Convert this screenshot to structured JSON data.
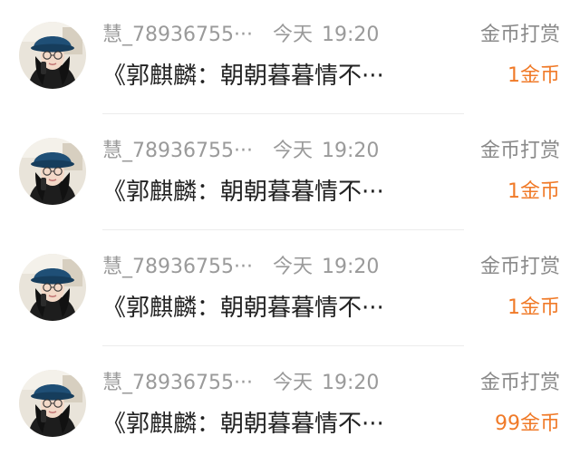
{
  "colors": {
    "accent": "#f07a28",
    "meta_text": "#9a9a9a",
    "primary_text": "#222222",
    "divider": "#ececec"
  },
  "tips": [
    {
      "avatar_icon": "user-avatar-photo",
      "username": "慧_78936755···",
      "date": "今天",
      "time": "19:20",
      "title": "《郭麒麟：朝朝暮暮情不···",
      "action": "金币打赏",
      "amount": "1金币"
    },
    {
      "avatar_icon": "user-avatar-photo",
      "username": "慧_78936755···",
      "date": "今天",
      "time": "19:20",
      "title": "《郭麒麟：朝朝暮暮情不···",
      "action": "金币打赏",
      "amount": "1金币"
    },
    {
      "avatar_icon": "user-avatar-photo",
      "username": "慧_78936755···",
      "date": "今天",
      "time": "19:20",
      "title": "《郭麒麟：朝朝暮暮情不···",
      "action": "金币打赏",
      "amount": "1金币"
    },
    {
      "avatar_icon": "user-avatar-photo",
      "username": "慧_78936755···",
      "date": "今天",
      "time": "19:20",
      "title": "《郭麒麟：朝朝暮暮情不···",
      "action": "金币打赏",
      "amount": "99金币"
    }
  ]
}
